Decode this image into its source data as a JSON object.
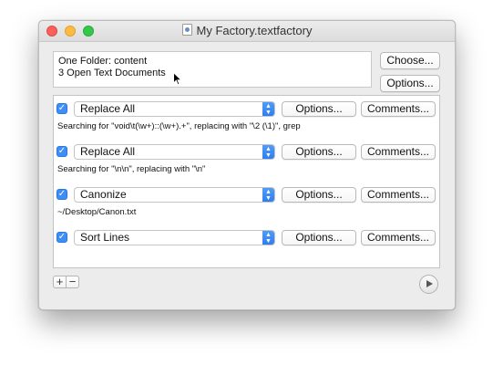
{
  "window": {
    "title": "My Factory.textfactory"
  },
  "sources": {
    "line1": "One Folder: content",
    "line2": "3 Open Text Documents"
  },
  "buttons": {
    "choose": "Choose...",
    "options": "Options..."
  },
  "actions": [
    {
      "enabled": true,
      "name": "Replace All",
      "description": "Searching for \"void\\t(\\w+)::(\\w+).+\", replacing with \"\\2 (\\1)\", grep",
      "options_label": "Options...",
      "comments_label": "Comments..."
    },
    {
      "enabled": true,
      "name": "Replace All",
      "description": "Searching for \"\\n\\n\", replacing with \"\\n\"",
      "options_label": "Options...",
      "comments_label": "Comments..."
    },
    {
      "enabled": true,
      "name": "Canonize",
      "description": "~/Desktop/Canon.txt",
      "options_label": "Options...",
      "comments_label": "Comments..."
    },
    {
      "enabled": true,
      "name": "Sort Lines",
      "description": "",
      "options_label": "Options...",
      "comments_label": "Comments..."
    }
  ],
  "toolbar": {
    "add": "+",
    "remove": "−"
  },
  "icons": {
    "checkbox": "checkmark-icon",
    "select": "updown-chevron-icon",
    "run": "play-icon",
    "doc": "textfactory-doc-icon"
  }
}
